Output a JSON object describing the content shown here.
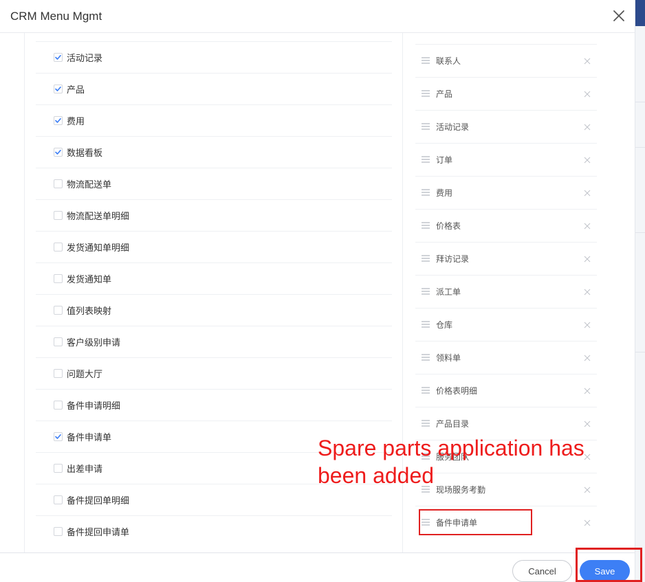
{
  "dialog": {
    "title": "CRM Menu Mgmt",
    "close_icon": "close-icon"
  },
  "left_menu": [
    {
      "label": "活动记录",
      "checked": true
    },
    {
      "label": "产品",
      "checked": true
    },
    {
      "label": "费用",
      "checked": true
    },
    {
      "label": "数据看板",
      "checked": true
    },
    {
      "label": "物流配送单",
      "checked": false
    },
    {
      "label": "物流配送单明细",
      "checked": false
    },
    {
      "label": "发货通知单明细",
      "checked": false
    },
    {
      "label": "发货通知单",
      "checked": false
    },
    {
      "label": "值列表映射",
      "checked": false
    },
    {
      "label": "客户级别申请",
      "checked": false
    },
    {
      "label": "问题大厅",
      "checked": false
    },
    {
      "label": "备件申请明细",
      "checked": false
    },
    {
      "label": "备件申请单",
      "checked": true
    },
    {
      "label": "出差申请",
      "checked": false
    },
    {
      "label": "备件提回单明细",
      "checked": false
    },
    {
      "label": "备件提回申请单",
      "checked": false
    }
  ],
  "selected_menu": [
    {
      "label": "联系人"
    },
    {
      "label": "产品"
    },
    {
      "label": "活动记录"
    },
    {
      "label": "订单"
    },
    {
      "label": "费用"
    },
    {
      "label": "价格表"
    },
    {
      "label": "拜访记录"
    },
    {
      "label": "派工单"
    },
    {
      "label": "仓库"
    },
    {
      "label": "领料单"
    },
    {
      "label": "价格表明细"
    },
    {
      "label": "产品目录"
    },
    {
      "label": "服务团队"
    },
    {
      "label": "现场服务考勤"
    },
    {
      "label": "备件申请单"
    }
  ],
  "annotation": {
    "text": "Spare parts application has been added",
    "color": "#ee1c1c"
  },
  "footer": {
    "cancel_label": "Cancel",
    "save_label": "Save"
  },
  "colors": {
    "primary": "#3d7ff5",
    "check": "#3d7ff5",
    "highlight": "#e02020"
  }
}
